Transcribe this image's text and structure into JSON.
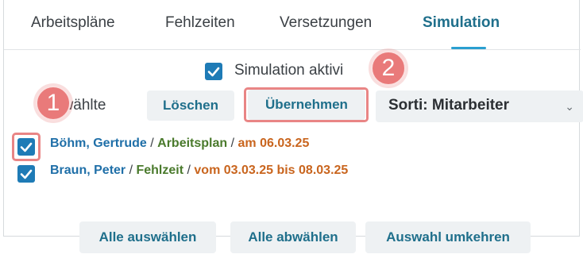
{
  "tabs": [
    "Arbeitspläne",
    "Fehlzeiten",
    "Versetzungen",
    "Simulation"
  ],
  "active_tab": "Simulation",
  "simulation": {
    "checkbox_label": "Simulation aktivi",
    "checked": true
  },
  "toolbar": {
    "selected_label": "ewählte",
    "delete_label": "Löschen",
    "apply_label": "Übernehmen",
    "sort_label": "Sorti: Mitarbeiter"
  },
  "entries": [
    {
      "name": "Böhm, Gertrude",
      "type": "Arbeitsplan",
      "date_text": "am 06.03.25",
      "checked": true
    },
    {
      "name": "Braun, Peter",
      "type": "Fehlzeit",
      "date_text": "vom 03.03.25 bis 08.03.25",
      "checked": true
    }
  ],
  "footer": {
    "select_all": "Alle auswählen",
    "deselect_all": "Alle abwählen",
    "invert": "Auswahl umkehren"
  },
  "markers": [
    "1",
    "2"
  ],
  "colors": {
    "accent": "#1f6f8b",
    "checkbox": "#1e7bb6",
    "highlight": "#e97a7a",
    "name": "#1f6fa8",
    "type": "#4a7a2c",
    "date": "#c9651e"
  },
  "icons": {
    "checkbox": "checkmark-icon",
    "dropdown": "chevron-down-icon"
  }
}
